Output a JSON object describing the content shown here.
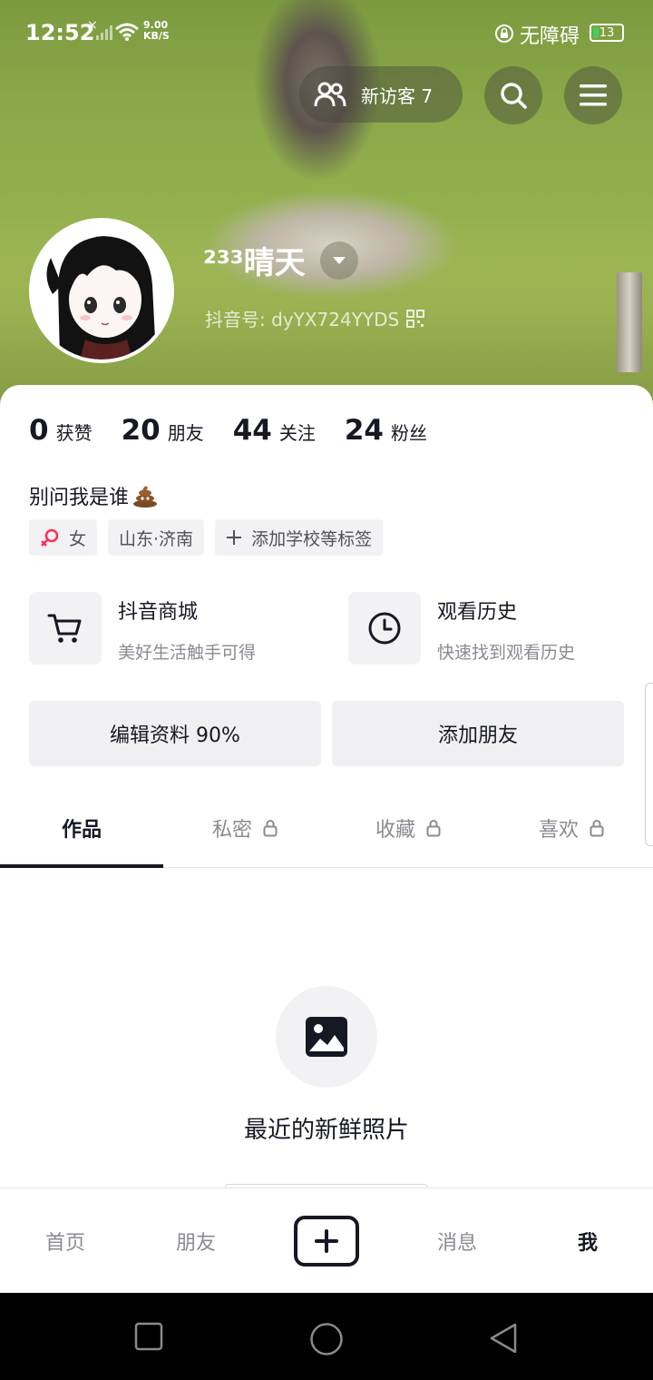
{
  "status_bar": {
    "time": "12:52",
    "signal_x": "×",
    "net_speed_value": "9.00",
    "net_speed_unit": "KB/S",
    "accessibility": "无障碍",
    "battery": "13"
  },
  "header": {
    "visitor_label": "新访客 7",
    "nickname": "²³³晴天",
    "douyin_id": "抖音号: dyYX724YYDS"
  },
  "stats": [
    {
      "num": "0",
      "label": "获赞"
    },
    {
      "num": "20",
      "label": "朋友"
    },
    {
      "num": "44",
      "label": "关注"
    },
    {
      "num": "24",
      "label": "粉丝"
    }
  ],
  "bio": "别问我是谁",
  "tags": {
    "gender": "女",
    "location": "山东·济南",
    "add_school": "添加学校等标签"
  },
  "features": {
    "mall": {
      "title": "抖音商城",
      "subtitle": "美好生活触手可得"
    },
    "history": {
      "title": "观看历史",
      "subtitle": "快速找到观看历史"
    }
  },
  "actions": {
    "edit_profile": "编辑资料 90%",
    "add_friend": "添加朋友"
  },
  "tabs": [
    {
      "label": "作品"
    },
    {
      "label": "私密"
    },
    {
      "label": "收藏"
    },
    {
      "label": "喜欢"
    }
  ],
  "empty_state": {
    "title": "最近的新鲜照片"
  },
  "bottom_nav": {
    "home": "首页",
    "friends": "朋友",
    "messages": "消息",
    "me": "我"
  },
  "colors": {
    "text_primary": "#161823",
    "text_secondary": "#8a8b91",
    "chip_bg": "#f2f2f4",
    "female_pink": "#fe2c55",
    "battery_green": "#3fd061"
  }
}
